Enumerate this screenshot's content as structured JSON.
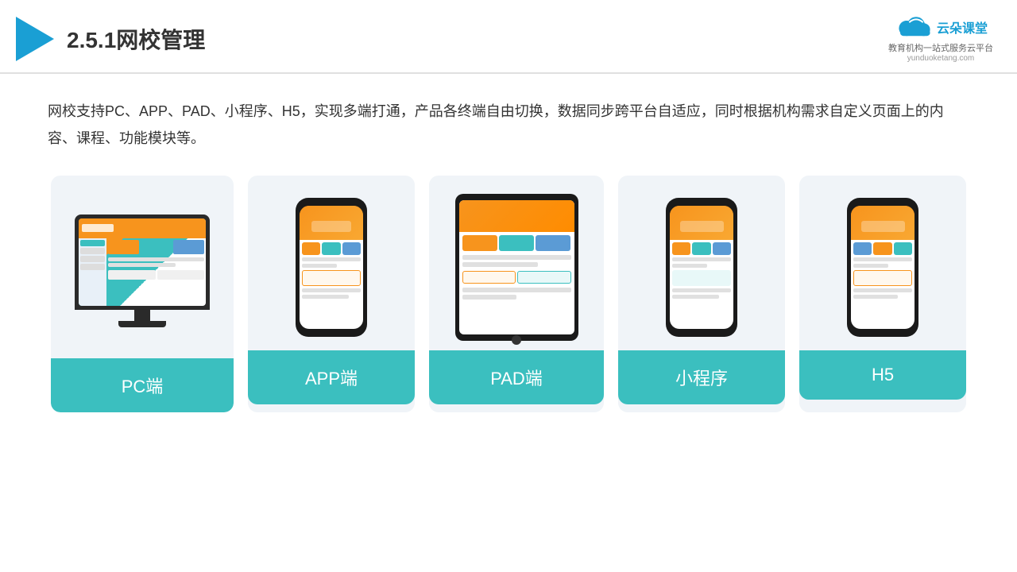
{
  "header": {
    "title": "2.5.1网校管理",
    "brand": {
      "name_cn": "云朵课堂",
      "tagline": "教育机构一站\n式服务云平台",
      "url": "yunduoketang.com"
    }
  },
  "description": "网校支持PC、APP、PAD、小程序、H5，实现多端打通，产品各终端自由切换，数据同步跨平台自适应，同时根据机构需求自定义页面上的内容、课程、功能模块等。",
  "cards": [
    {
      "id": "pc",
      "label": "PC端"
    },
    {
      "id": "app",
      "label": "APP端"
    },
    {
      "id": "pad",
      "label": "PAD端"
    },
    {
      "id": "miniprogram",
      "label": "小程序"
    },
    {
      "id": "h5",
      "label": "H5"
    }
  ]
}
